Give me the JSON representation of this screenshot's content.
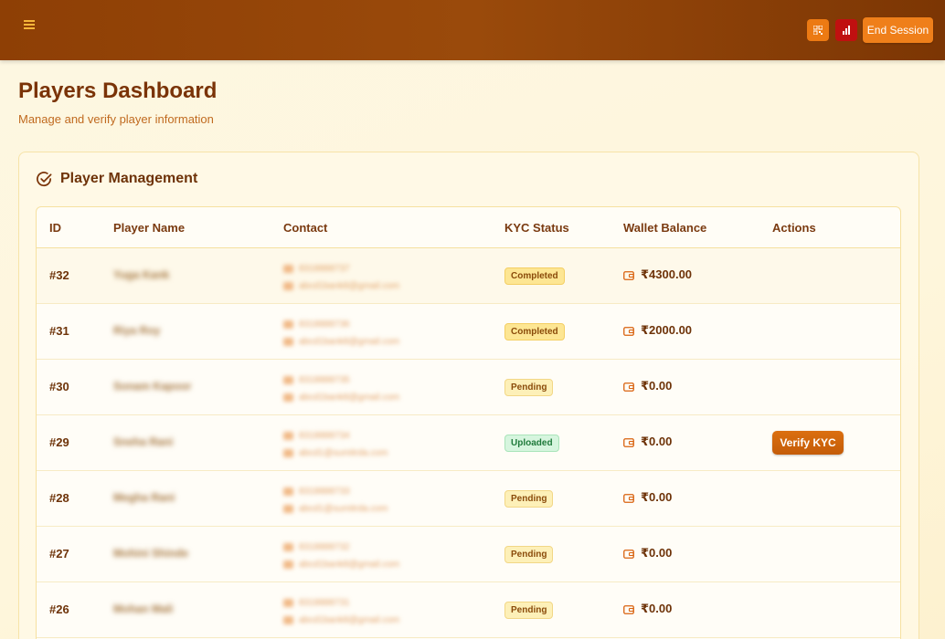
{
  "header": {
    "menu_icon": "hamburger-menu-icon",
    "qr_icon": "qr-code-icon",
    "stats_icon": "bar-chart-icon",
    "end_session_label": "End Session"
  },
  "page": {
    "title": "Players Dashboard",
    "subtitle": "Manage and verify player information"
  },
  "card": {
    "title": "Player Management",
    "title_icon": "check-circle-icon"
  },
  "table": {
    "columns": [
      "ID",
      "Player Name",
      "Contact",
      "KYC Status",
      "Wallet Balance",
      "Actions"
    ],
    "rows": [
      {
        "id": "#32",
        "name": "Yuga Kank",
        "phone": "8318888737",
        "email": "abcd1bank8@gmail.com",
        "status": "Completed",
        "balance": "₹4300.00",
        "action": ""
      },
      {
        "id": "#31",
        "name": "Riya Roy",
        "phone": "8318888736",
        "email": "abcd1bank8@gmail.com",
        "status": "Completed",
        "balance": "₹2000.00",
        "action": ""
      },
      {
        "id": "#30",
        "name": "Sonam Kapoor",
        "phone": "8318888735",
        "email": "abcd1bank8@gmail.com",
        "status": "Pending",
        "balance": "₹0.00",
        "action": ""
      },
      {
        "id": "#29",
        "name": "Sneha Rani",
        "phone": "8318888734",
        "email": "abcd1@sumitrda.com",
        "status": "Uploaded",
        "balance": "₹0.00",
        "action": "Verify KYC"
      },
      {
        "id": "#28",
        "name": "Megha Rani",
        "phone": "8318888733",
        "email": "abcd1@sumitrda.com",
        "status": "Pending",
        "balance": "₹0.00",
        "action": ""
      },
      {
        "id": "#27",
        "name": "Mohini Shinde",
        "phone": "8318888732",
        "email": "abcd1bank8@gmail.com",
        "status": "Pending",
        "balance": "₹0.00",
        "action": ""
      },
      {
        "id": "#26",
        "name": "Mohan Mali",
        "phone": "8318888731",
        "email": "abcd1bank8@gmail.com",
        "status": "Pending",
        "balance": "₹0.00",
        "action": ""
      }
    ]
  },
  "colors": {
    "header_bg": "#8e3f05",
    "accent": "#ef7f1a",
    "danger": "#c01010",
    "title_text": "#7a3307"
  }
}
